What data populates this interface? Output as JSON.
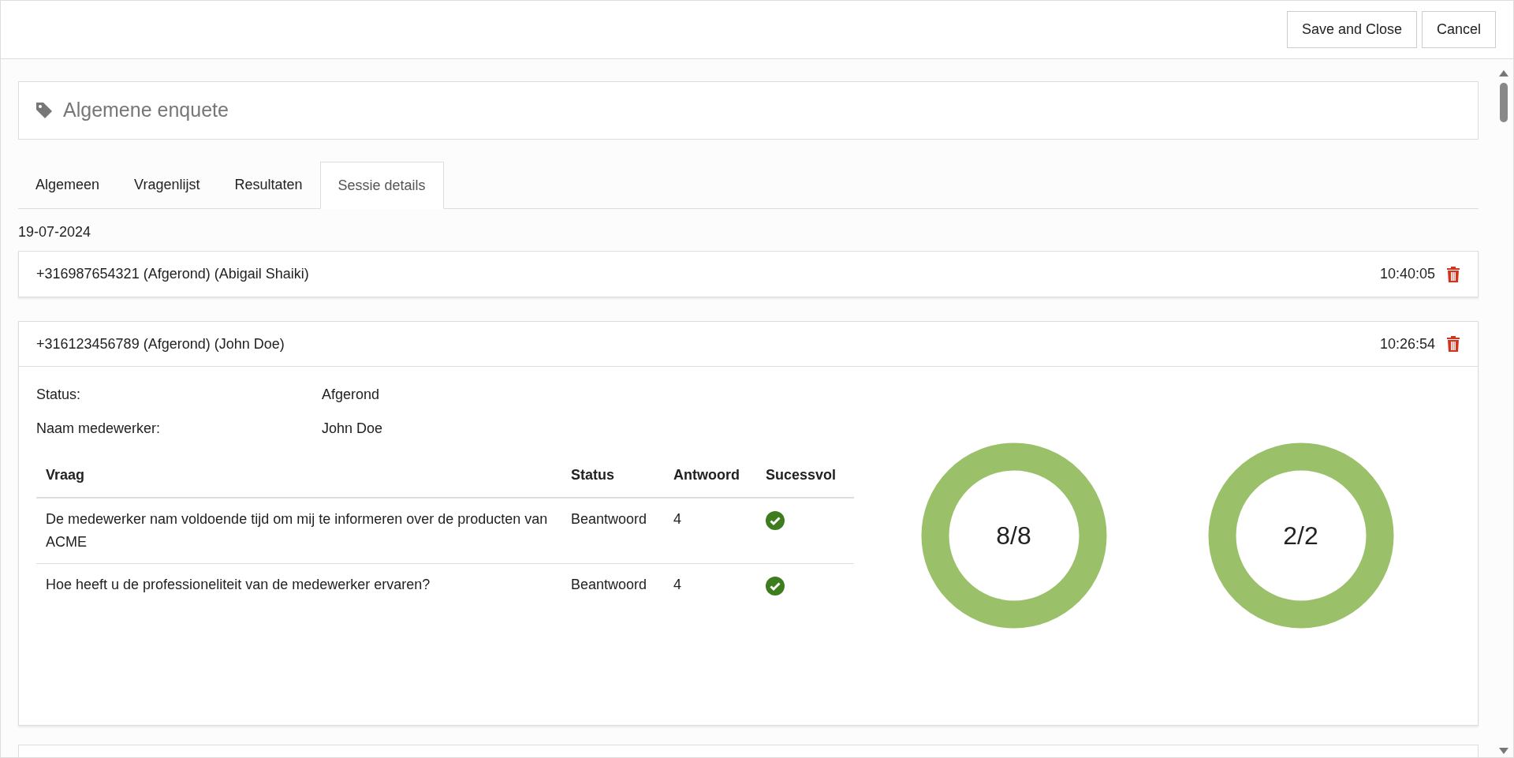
{
  "toolbar": {
    "buttons": [
      "Save and Close",
      "Cancel"
    ]
  },
  "header": {
    "title": "Algemene enquete"
  },
  "tabs": [
    {
      "label": "Algemeen",
      "selected": false
    },
    {
      "label": "Vragenlijst",
      "selected": false
    },
    {
      "label": "Resultaten",
      "selected": false
    },
    {
      "label": "Sessie details",
      "selected": true
    }
  ],
  "date": "19-07-2024",
  "sessions": [
    {
      "title": "+316987654321 (Afgerond) (Abigail Shaiki)",
      "time": "10:40:05",
      "expanded": false
    },
    {
      "title": "+316123456789 (Afgerond) (John Doe)",
      "time": "10:26:54",
      "expanded": true,
      "details": [
        {
          "label": "Status:",
          "value": "Afgerond"
        },
        {
          "label": "Naam medewerker:",
          "value": "John Doe"
        }
      ],
      "table": {
        "columns": [
          "Vraag",
          "Status",
          "Antwoord",
          "Sucessvol"
        ],
        "rows": [
          {
            "question": "De medewerker nam voldoende tijd om mij te informeren over de producten van ACME",
            "status": "Beantwoord",
            "answer": "4",
            "successful": true
          },
          {
            "question": "Hoe heeft u de professioneliteit van de medewerker ervaren?",
            "status": "Beantwoord",
            "answer": "4",
            "successful": true
          }
        ]
      },
      "gauges": [
        {
          "label": "8/8"
        },
        {
          "label": "2/2"
        }
      ]
    }
  ]
}
